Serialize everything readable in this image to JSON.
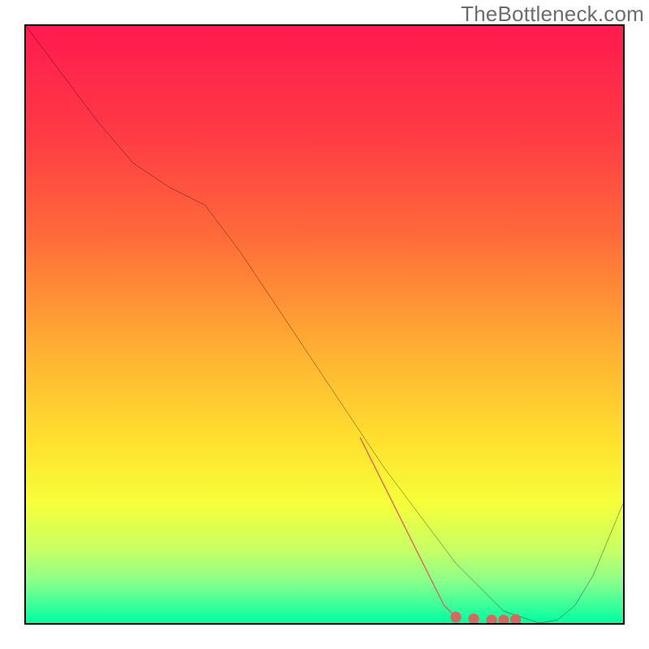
{
  "watermark": "TheBottleneck.com",
  "chart_data": {
    "type": "line",
    "title": "",
    "xlabel": "",
    "ylabel": "",
    "xlim": [
      0,
      100
    ],
    "ylim": [
      0,
      100
    ],
    "gradient_stops": [
      {
        "offset": 0.0,
        "color": "#ff1a4f"
      },
      {
        "offset": 0.18,
        "color": "#ff3a45"
      },
      {
        "offset": 0.35,
        "color": "#ff6a3a"
      },
      {
        "offset": 0.55,
        "color": "#ffb233"
      },
      {
        "offset": 0.7,
        "color": "#ffe22e"
      },
      {
        "offset": 0.8,
        "color": "#f6ff3a"
      },
      {
        "offset": 0.88,
        "color": "#c6ff66"
      },
      {
        "offset": 0.93,
        "color": "#8aff8a"
      },
      {
        "offset": 0.97,
        "color": "#3cff9a"
      },
      {
        "offset": 1.0,
        "color": "#00ffa0"
      }
    ],
    "curve": {
      "x": [
        0,
        6,
        12,
        18,
        24,
        30,
        36,
        42,
        48,
        54,
        60,
        63,
        66,
        69,
        72,
        75,
        78,
        80,
        83,
        86,
        89,
        92,
        95,
        100
      ],
      "y": [
        100,
        92,
        84,
        77,
        73,
        70,
        62,
        53,
        44,
        35,
        26,
        22,
        18,
        14,
        10,
        7,
        4,
        2,
        1,
        0,
        0.5,
        3,
        8,
        20
      ]
    },
    "overlay_segment": {
      "color": "#d46a5e",
      "thick_line": {
        "x": [
          56,
          58,
          60,
          62,
          64,
          66,
          68,
          70,
          72
        ],
        "y": [
          31,
          27,
          23,
          19,
          15,
          11,
          7,
          3,
          1
        ]
      },
      "dots": {
        "x": [
          72,
          75,
          78,
          80,
          82
        ],
        "y": [
          1,
          0.7,
          0.5,
          0.5,
          0.6
        ]
      }
    }
  }
}
